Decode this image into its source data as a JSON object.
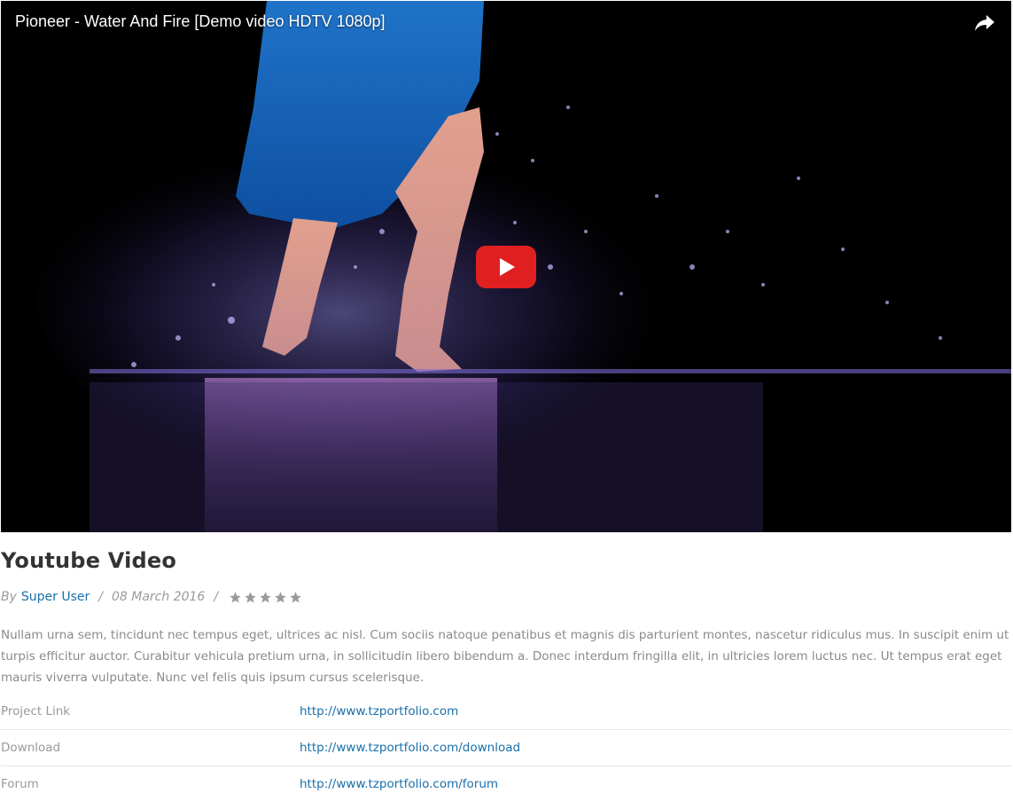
{
  "video": {
    "title": "Pioneer - Water And Fire [Demo video HDTV 1080p]",
    "share_icon": "share-arrow-icon",
    "play_icon": "youtube-play-icon",
    "play_color": "#e02020"
  },
  "article": {
    "title": "Youtube Video",
    "by_label": "By",
    "author": "Super User",
    "separator": "/",
    "date": "08 March 2016",
    "rating": {
      "value": 0,
      "max": 5,
      "icon": "star-icon"
    },
    "description": "Nullam urna sem, tincidunt nec tempus eget, ultrices ac nisl. Cum sociis natoque penatibus et magnis dis parturient montes, nascetur ridiculus mus. In suscipit enim ut turpis efficitur auctor. Curabitur vehicula pretium urna, in sollicitudin libero bibendum a. Donec interdum fringilla elit, in ultricies lorem luctus nec. Ut tempus erat eget mauris viverra vulputate. Nunc vel felis quis ipsum cursus scelerisque."
  },
  "fields": [
    {
      "label": "Project Link",
      "value": "http://www.tzportfolio.com"
    },
    {
      "label": "Download",
      "value": "http://www.tzportfolio.com/download"
    },
    {
      "label": "Forum",
      "value": "http://www.tzportfolio.com/forum"
    }
  ],
  "colors": {
    "link": "#1a6fa8",
    "title": "#333333",
    "muted": "#9a9a9a",
    "star": "#9a9a9a"
  }
}
